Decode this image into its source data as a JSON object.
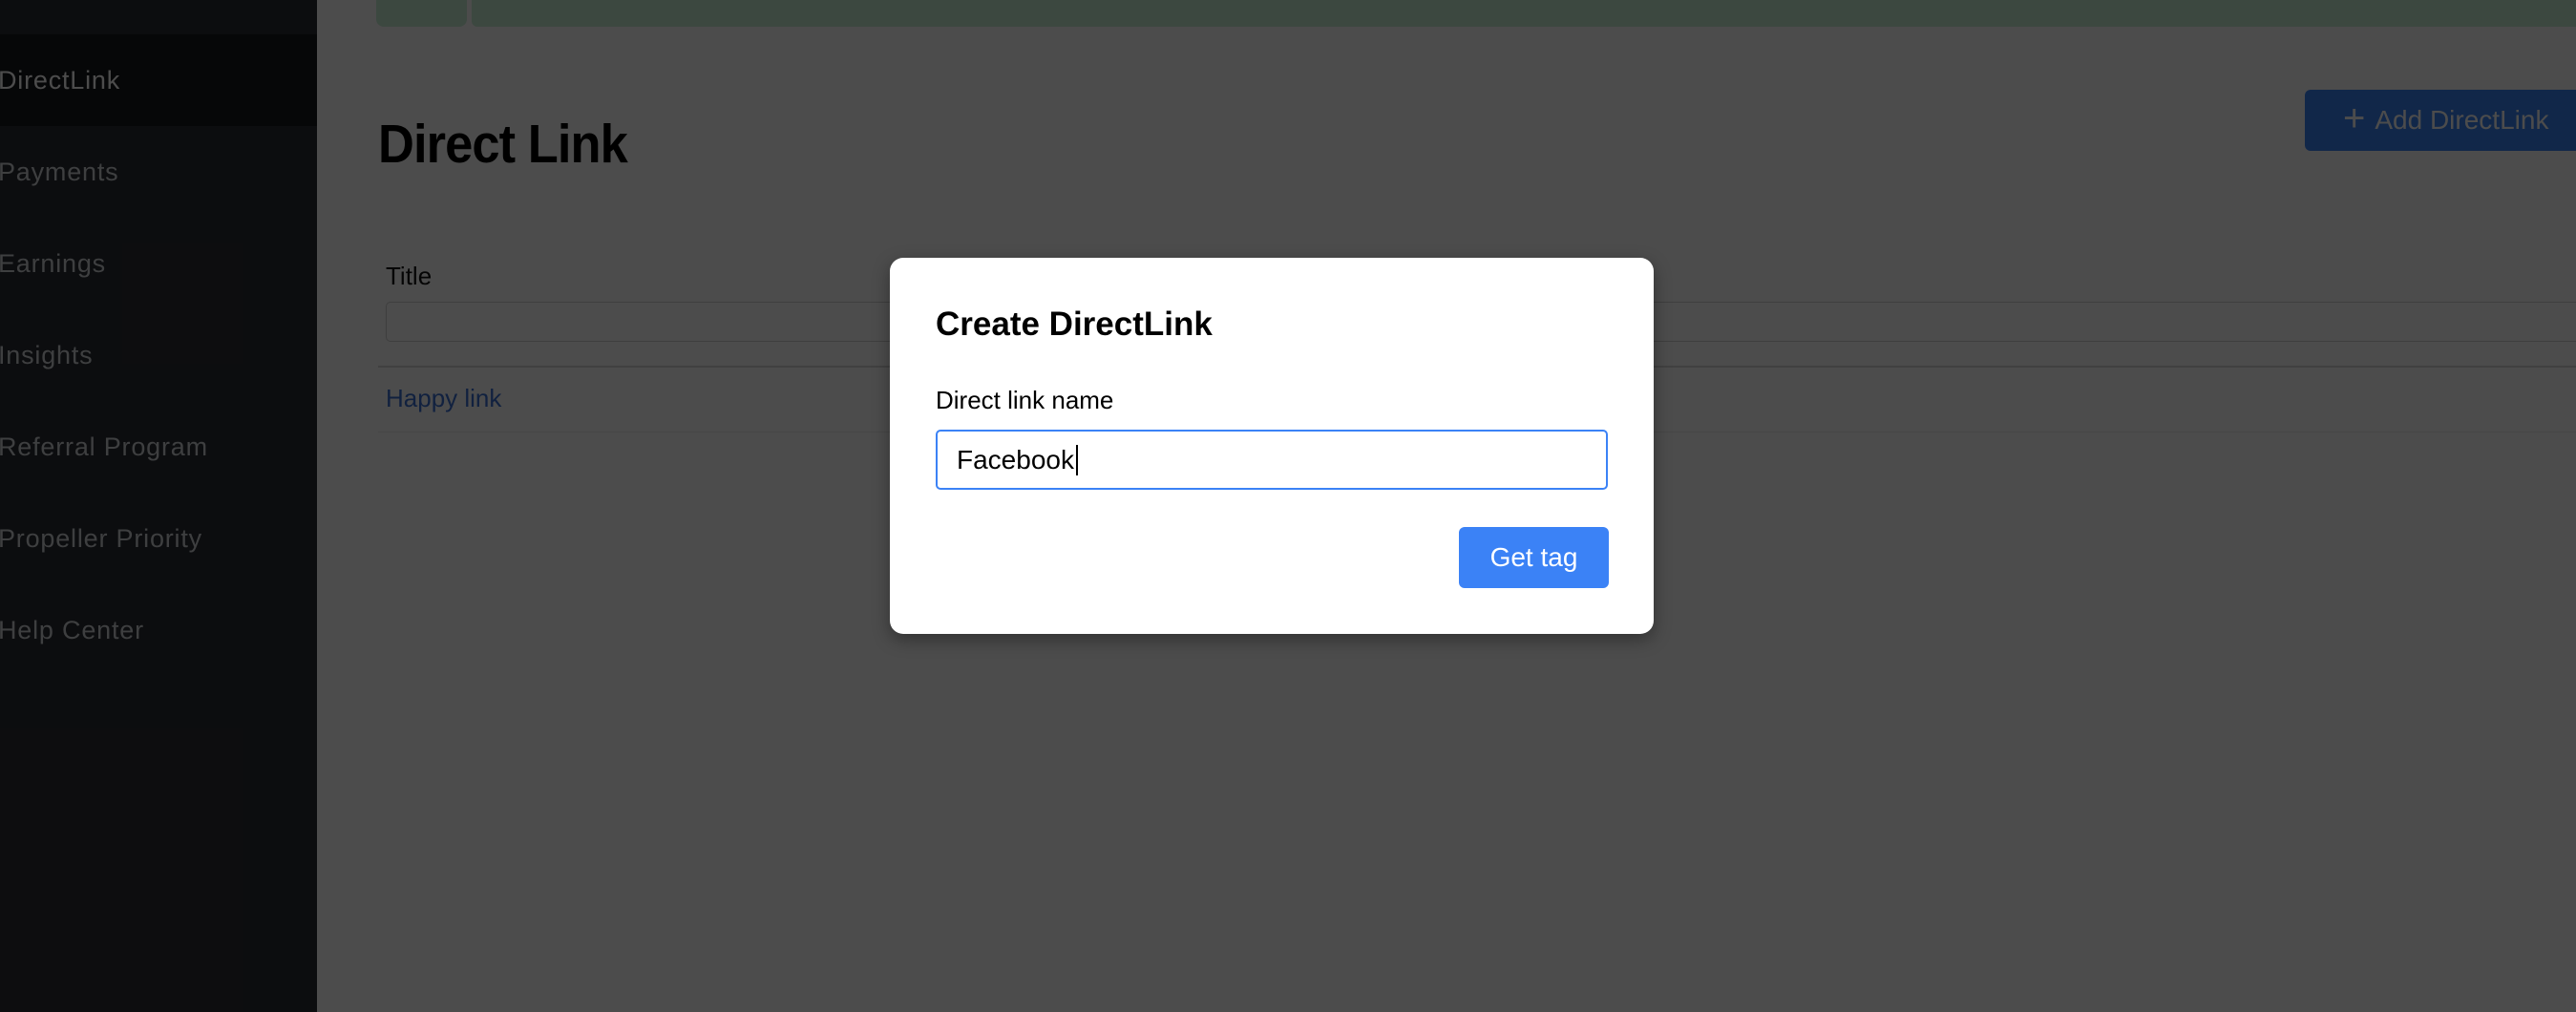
{
  "sidebar": {
    "items": [
      {
        "label": "DirectLink",
        "active": true
      },
      {
        "label": "Payments",
        "active": false
      },
      {
        "label": "Earnings",
        "active": false
      },
      {
        "label": "Insights",
        "active": false
      },
      {
        "label": "Referral Program",
        "active": false
      },
      {
        "label": "Propeller Priority",
        "active": false
      },
      {
        "label": "Help Center",
        "active": false
      }
    ]
  },
  "main": {
    "page_title": "Direct Link",
    "add_button_label": "Add DirectLink",
    "add_button_icon": "plus-icon",
    "filter": {
      "label": "Title",
      "value": "",
      "placeholder": ""
    },
    "rows": [
      {
        "title": "Happy link"
      }
    ]
  },
  "modal": {
    "title": "Create DirectLink",
    "field_label": "Direct link name",
    "field_value": "Facebook",
    "submit_label": "Get tag"
  },
  "colors": {
    "accent": "#3b82f6",
    "banner_green": "#c8f0d6",
    "sidebar_bg": "#2a2c33",
    "overlay": "rgba(0,0,0,0.70)"
  }
}
